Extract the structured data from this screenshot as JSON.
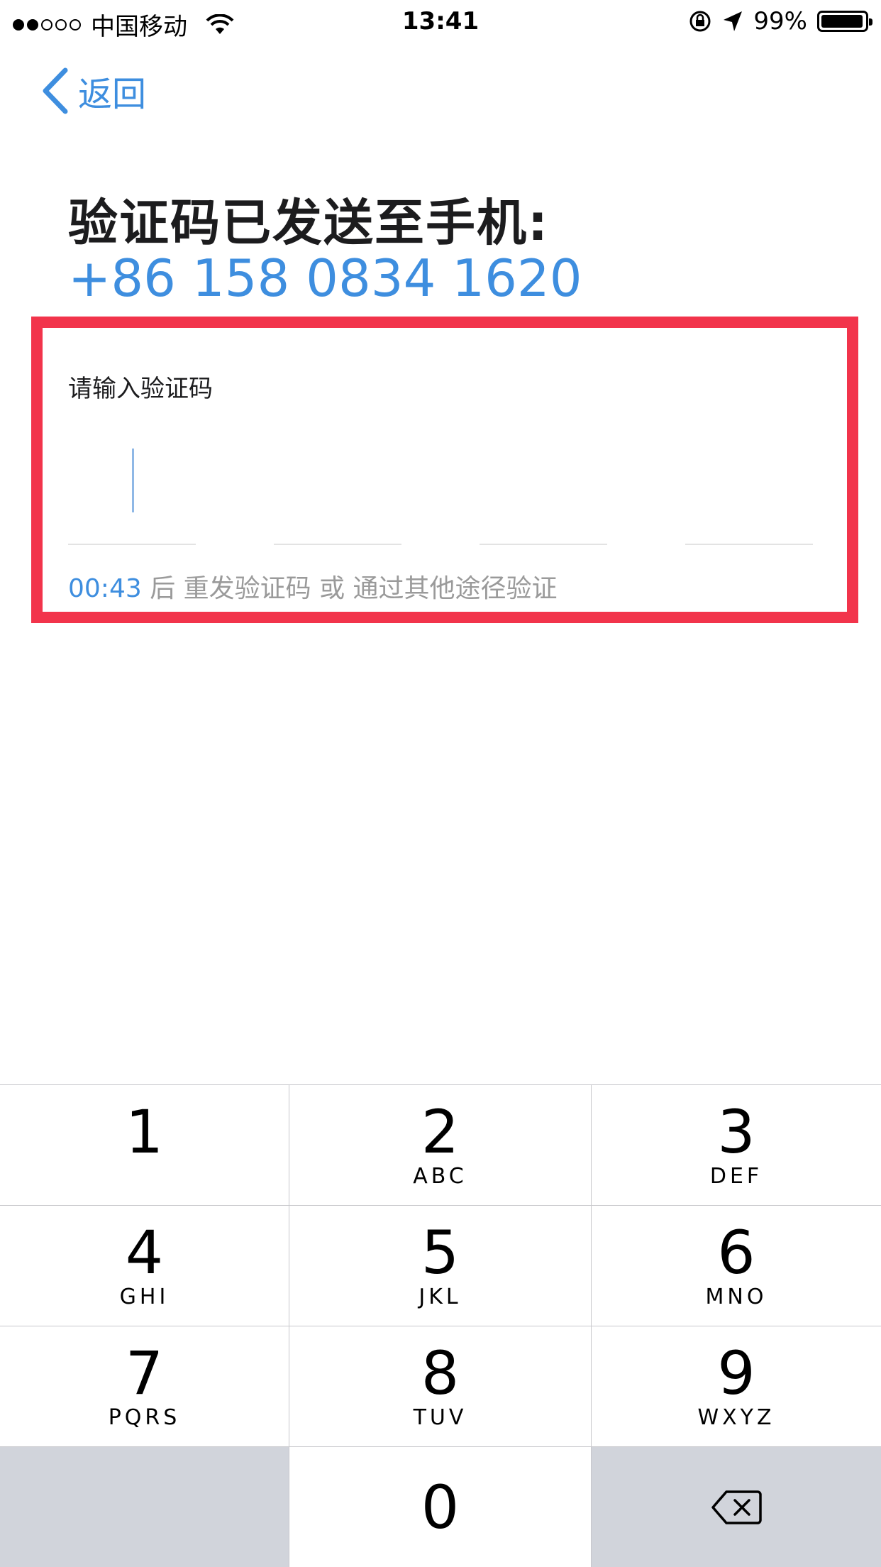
{
  "status_bar": {
    "carrier": "中国移动",
    "time": "13:41",
    "battery": "99%",
    "signal_filled": 2,
    "signal_total": 5
  },
  "nav": {
    "back_label": "返回"
  },
  "header": {
    "title": "验证码已发送至手机:",
    "phone": "+86 158 0834 1620"
  },
  "code_input": {
    "label": "请输入验证码",
    "slots": [
      "",
      "",
      "",
      ""
    ],
    "timer": "00:43",
    "resend_text": "后 重发验证码 或 通过其他途径验证"
  },
  "keypad": {
    "keys": [
      {
        "digit": "1",
        "letters": ""
      },
      {
        "digit": "2",
        "letters": "ABC"
      },
      {
        "digit": "3",
        "letters": "DEF"
      },
      {
        "digit": "4",
        "letters": "GHI"
      },
      {
        "digit": "5",
        "letters": "JKL"
      },
      {
        "digit": "6",
        "letters": "MNO"
      },
      {
        "digit": "7",
        "letters": "PQRS"
      },
      {
        "digit": "8",
        "letters": "TUV"
      },
      {
        "digit": "9",
        "letters": "WXYZ"
      },
      {
        "digit": "0",
        "letters": ""
      }
    ]
  },
  "colors": {
    "accent": "#3e8edf",
    "highlight": "#f2344b",
    "keypad_gray": "#d1d4db"
  }
}
